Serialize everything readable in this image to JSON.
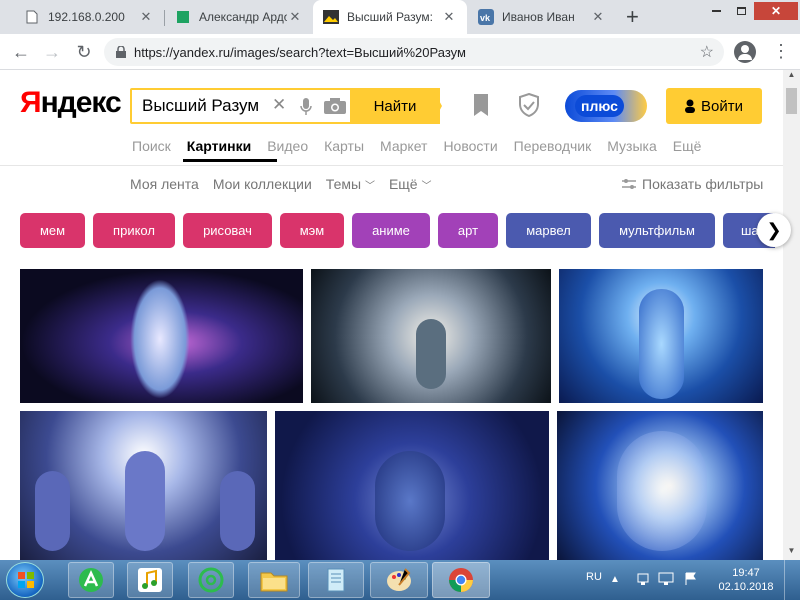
{
  "browser": {
    "tabs": [
      {
        "title": "192.168.0.200",
        "icon": "page-icon"
      },
      {
        "title": "Александр Ардо",
        "icon": "sheet-icon"
      },
      {
        "title": "Высший Разум:",
        "icon": "image-icon"
      },
      {
        "title": "Иванов Иван",
        "icon": "vk-icon"
      }
    ],
    "new_tab": "+",
    "url": "https://yandex.ru/images/search?text=Высший%20Разум"
  },
  "yandex": {
    "logo_first": "Я",
    "logo_rest": "ндекс",
    "search_value": "Высший Разум",
    "find_label": "Найти",
    "plus_label": "плюс",
    "login_label": "Войти",
    "nav": [
      "Поиск",
      "Картинки",
      "Видео",
      "Карты",
      "Маркет",
      "Новости",
      "Переводчик",
      "Музыка",
      "Ещё"
    ],
    "subnav": {
      "feed": "Моя лента",
      "collections": "Мои коллекции",
      "themes": "Темы",
      "more": "Ещё",
      "filters": "Показать фильтры"
    },
    "chips": [
      {
        "label": "мем",
        "color": "#d9346b"
      },
      {
        "label": "прикол",
        "color": "#d9346b"
      },
      {
        "label": "рисовач",
        "color": "#d9346b"
      },
      {
        "label": "мэм",
        "color": "#d9346b"
      },
      {
        "label": "аниме",
        "color": "#a241b8"
      },
      {
        "label": "арт",
        "color": "#a241b8"
      },
      {
        "label": "марвел",
        "color": "#4b5aaf"
      },
      {
        "label": "мультфильм",
        "color": "#4b5aaf"
      },
      {
        "label": "ша",
        "color": "#4b5aaf"
      }
    ]
  },
  "taskbar": {
    "lang": "RU",
    "time": "19:47",
    "date": "02.10.2018"
  },
  "colors": {
    "accent": "#ffcc33",
    "plus": "#0c4bd8",
    "logo_red": "#ff0000"
  }
}
